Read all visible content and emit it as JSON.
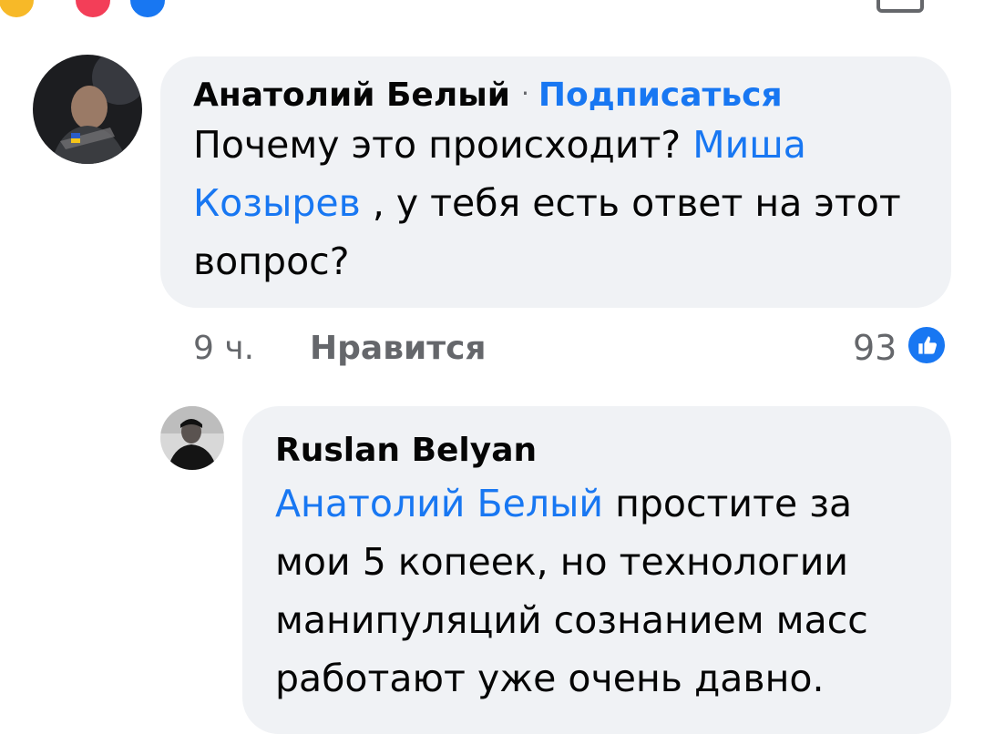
{
  "comments": [
    {
      "author": "Анатолий Белый",
      "separator": "·",
      "follow_label": "Подписаться",
      "text_part1": "Почему это происходит? ",
      "mention": "Миша Козырев",
      "text_part2": " , у тебя есть ответ на этот вопрос?",
      "time": "9 ч.",
      "like_label": "Нравится",
      "reaction_count": "93"
    }
  ],
  "replies": [
    {
      "author": "Ruslan Belyan",
      "mention": "Анатолий Белый",
      "text": " простите за мои 5 копеек, но технологии манипуляций сознанием масс работают уже очень давно."
    }
  ],
  "colors": {
    "link": "#1877f2",
    "bubble": "#f0f2f5",
    "secondary_text": "#65676b"
  },
  "icons": {
    "like_badge": "thumbs-up-icon"
  }
}
